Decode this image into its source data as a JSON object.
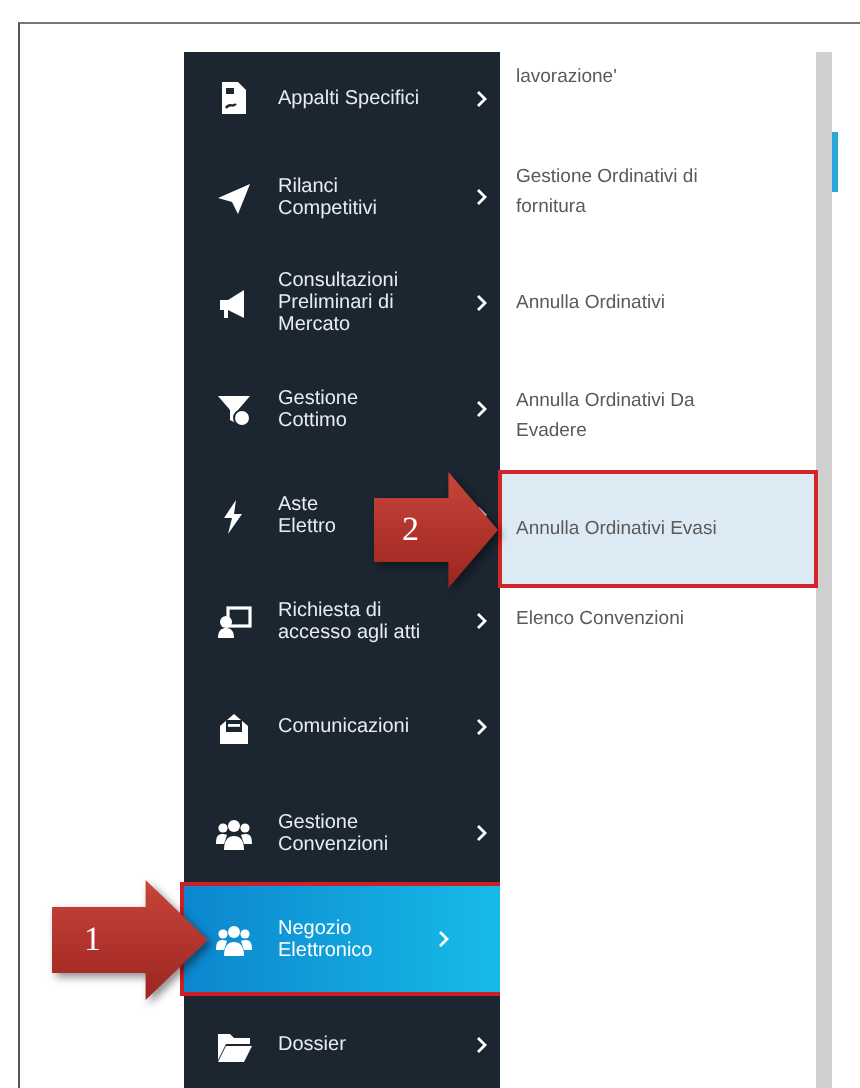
{
  "sidebar": {
    "items": [
      {
        "label": "Appalti Specifici",
        "selected": false
      },
      {
        "label": "Rilanci Competitivi",
        "selected": false
      },
      {
        "label": "Consultazioni Preliminari di Mercato",
        "selected": false
      },
      {
        "label": "Gestione Cottimo",
        "selected": false
      },
      {
        "label": "Aste\nElettro",
        "selected": false
      },
      {
        "label": "Richiesta di accesso agli atti",
        "selected": false
      },
      {
        "label": "Comunicazioni",
        "selected": false
      },
      {
        "label": "Gestione Convenzioni",
        "selected": false
      },
      {
        "label": "Negozio Elettronico",
        "selected": true,
        "callout": "1"
      },
      {
        "label": "Dossier",
        "selected": false
      }
    ]
  },
  "submenu": {
    "items": [
      {
        "label": "lavorazione'",
        "selected": false
      },
      {
        "label": "Gestione Ordinativi di fornitura",
        "selected": false
      },
      {
        "label": "Annulla Ordinativi",
        "selected": false
      },
      {
        "label": "Annulla Ordinativi Da Evadere",
        "selected": false
      },
      {
        "label": "Annulla Ordinativi Evasi",
        "selected": true,
        "callout": "2"
      },
      {
        "label": "Elenco Convenzioni",
        "selected": false
      }
    ]
  }
}
